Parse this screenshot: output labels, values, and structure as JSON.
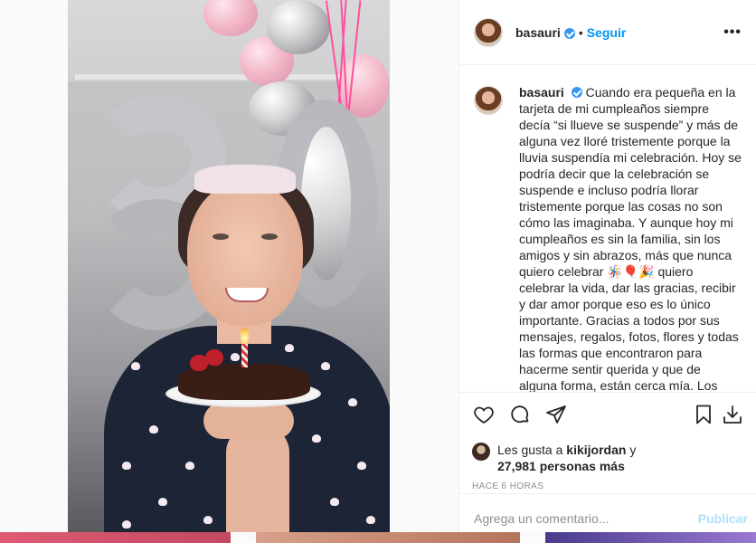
{
  "post": {
    "image_alt": "",
    "author": "basauri",
    "follow_label": "Seguir",
    "separator": "•",
    "more_label": "•••"
  },
  "caption": {
    "username": "basauri",
    "text": "Cuando era pequeña en la tarjeta de mi cumpleaños siempre decía “si llueve se suspende” y más de alguna vez lloré tristemente porque la lluvia suspendía mi celebración. Hoy se podría decir que la celebración se suspende e incluso podría llorar tristemente porque las cosas no son cómo las imaginaba. Y aunque hoy mi cumpleaños es sin la familia, sin los amigos y sin abrazos, más que nunca quiero celebrar 🪅🎈🎉 quiero celebrar la vida, dar las gracias, recibir y dar amor porque eso es lo único importante. Gracias a todos por sus mensajes, regalos, fotos, flores y todas las formas que encontraron para hacerme sentir querida y que de alguna forma, están cerca mía. Los"
  },
  "actions": {
    "like_icon": "heart-icon",
    "comment_icon": "comment-icon",
    "share_icon": "share-icon",
    "save_icon": "bookmark-icon",
    "download_icon": "download-icon"
  },
  "likes": {
    "prefix": "Les gusta a",
    "user": "kikijordan",
    "conj": "y",
    "count": "27,981 personas más"
  },
  "timestamp": "HACE 6 HORAS",
  "comment": {
    "placeholder": "Agrega un comentario...",
    "publish_label": "Publicar"
  },
  "colors": {
    "accent": "#0095f6",
    "verified": "#3897f0",
    "publish_disabled": "#b2dffc",
    "muted": "#8e8e8e"
  }
}
